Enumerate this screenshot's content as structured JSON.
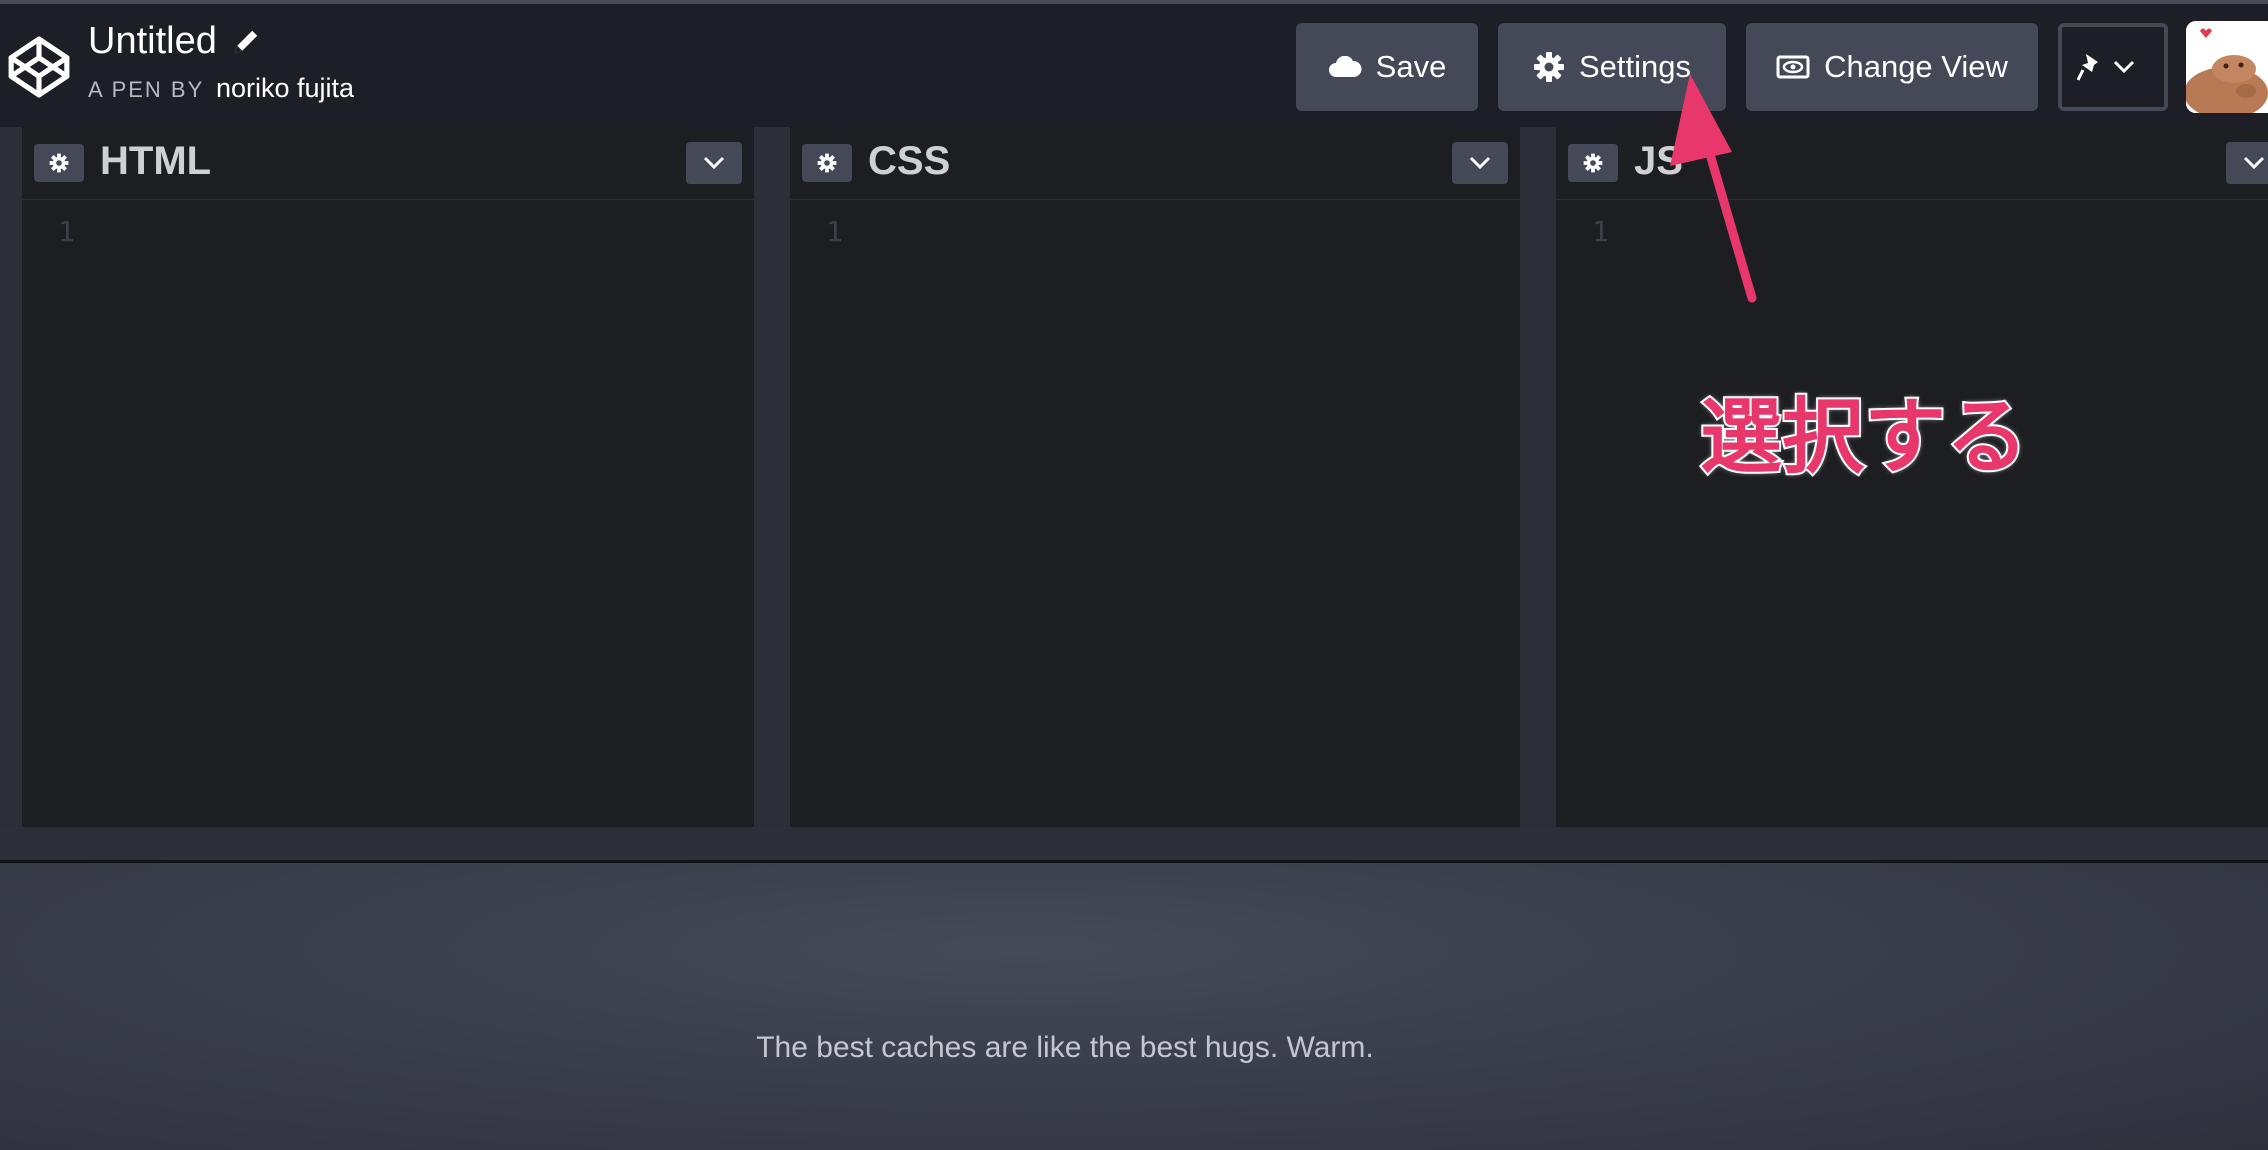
{
  "header": {
    "title": "Untitled",
    "byline_prefix": "A PEN BY",
    "author": "noriko fujita",
    "buttons": {
      "save": "Save",
      "settings": "Settings",
      "change_view": "Change View"
    }
  },
  "panels": [
    {
      "title": "HTML",
      "line": "1"
    },
    {
      "title": "CSS",
      "line": "1"
    },
    {
      "title": "JS",
      "line": "1"
    }
  ],
  "preview": {
    "tagline": "The best caches are like the best hugs. Warm."
  },
  "annotation": {
    "text": "選択する",
    "color": "#e8386b"
  },
  "icons": [
    "codepen-logo-icon",
    "pencil-icon",
    "cloud-icon",
    "gear-icon",
    "eye-icon",
    "pin-icon",
    "chevron-down-icon"
  ]
}
